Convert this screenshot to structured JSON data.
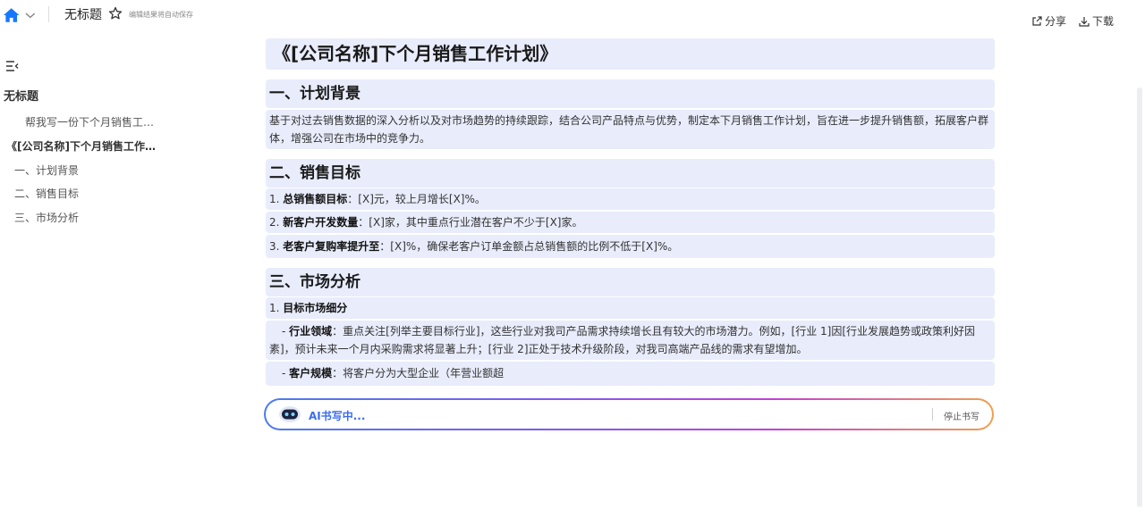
{
  "header": {
    "title": "无标题",
    "autosave": "编辑结果将自动保存",
    "share_label": "分享",
    "download_label": "下载"
  },
  "sidebar": {
    "doc_title": "无标题",
    "prompt": "帮我写一份下个月销售工…",
    "outline_h1": "《[公司名称]下个月销售工作…",
    "outline": [
      "一、计划背景",
      "二、销售目标",
      "三、市场分析"
    ]
  },
  "document": {
    "title": "《[公司名称]下个月销售工作计划》",
    "s1_heading": "一、计划背景",
    "s1_body": "基于对过去销售数据的深入分析以及对市场趋势的持续跟踪，结合公司产品特点与优势，制定本下月销售工作计划，旨在进一步提升销售额，拓展客户群体，增强公司在市场中的竞争力。",
    "s2_heading": "二、销售目标",
    "s2_items": [
      {
        "num": "1.",
        "label": "总销售额目标",
        "text": "：[X]元，较上月增长[X]%。"
      },
      {
        "num": "2.",
        "label": "新客户开发数量",
        "text": "：[X]家，其中重点行业潜在客户不少于[X]家。"
      },
      {
        "num": "3.",
        "label": "老客户复购率提升至",
        "text": "：[X]%，确保老客户订单金额占总销售额的比例不低于[X]%。"
      }
    ],
    "s3_heading": "三、市场分析",
    "s3_sub": {
      "num": "1.",
      "label": "目标市场细分"
    },
    "s3_industry": {
      "dash": "- ",
      "label": "行业领域",
      "text": "：重点关注[列举主要目标行业]，这些行业对我司产品需求持续增长且有较大的市场潜力。例如，[行业 1]因[行业发展趋势或政策利好因素]，预计未来一个月内采购需求将显著上升；[行业 2]正处于技术升级阶段，对我司高端产品线的需求有望增加。"
    },
    "s3_scale": {
      "dash": "- ",
      "label": "客户规模",
      "text": "：将客户分为大型企业（年营业额超"
    }
  },
  "ai_bar": {
    "status": "AI书写中...",
    "stop_label": "停止书写"
  },
  "colors": {
    "accent": "#3b6df0",
    "block_bg": "#e8ecfb",
    "home_icon": "#1677ff"
  }
}
